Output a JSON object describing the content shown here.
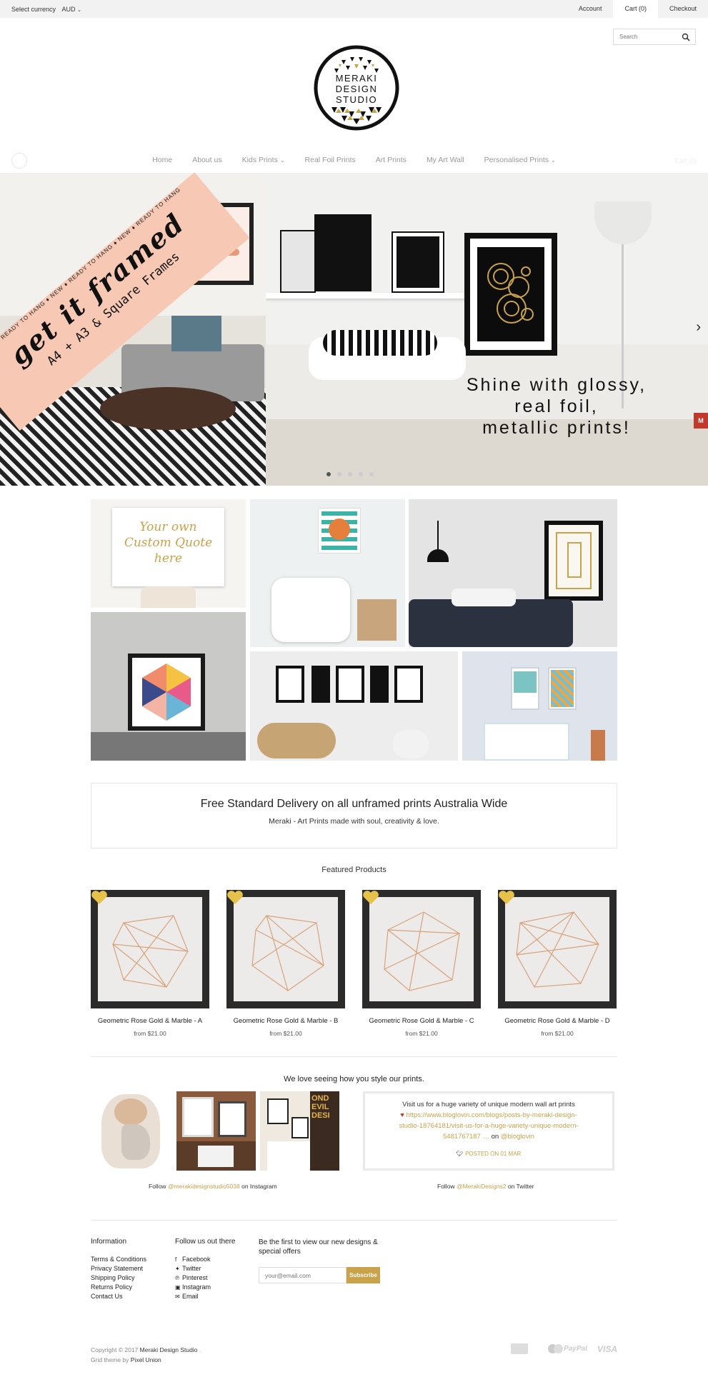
{
  "topbar": {
    "currency_label": "Select currency",
    "currency_value": "AUD",
    "account": "Account",
    "cart": "Cart (0)",
    "checkout": "Checkout"
  },
  "search": {
    "placeholder": "Search"
  },
  "logo": {
    "line1": "MERAKI",
    "line2": "DESIGN",
    "line3": "STUDIO"
  },
  "nav": {
    "items": [
      "Home",
      "About us",
      "Kids Prints",
      "Real Foil Prints",
      "Art Prints",
      "My Art Wall",
      "Personalised Prints"
    ],
    "cart_faint": "Cart (0)"
  },
  "hero": {
    "banner_main": "get it framed",
    "banner_small": "NEW ♦ READY TO HANG ♦ NEW ♦ READY TO HANG ♦ NEW ♦ READY TO HANG",
    "banner_sub": "A4 + A3 & Square Frames",
    "tagline_1": "Shine with glossy,",
    "tagline_2": "real foil,",
    "tagline_3": "metallic prints!",
    "slide_count": 5,
    "active_slide": 1
  },
  "collage": {
    "quote_text": "Your own Custom Quote here"
  },
  "delivery": {
    "headline": "Free Standard Delivery on all unframed prints Australia Wide",
    "subline": "Meraki - Art Prints made with soul, creativity & love."
  },
  "featured": {
    "title": "Featured Products",
    "products": [
      {
        "name": "Geometric Rose Gold & Marble - A",
        "price": "from $21.00"
      },
      {
        "name": "Geometric Rose Gold & Marble - B",
        "price": "from $21.00"
      },
      {
        "name": "Geometric Rose Gold & Marble - C",
        "price": "from $21.00"
      },
      {
        "name": "Geometric Rose Gold & Marble - D",
        "price": "from $21.00"
      }
    ]
  },
  "social": {
    "title": "We love seeing how you style our prints.",
    "instagram_follow_prefix": "Follow",
    "instagram_handle": "@merakidesignstudio5038",
    "instagram_suffix": "on Instagram",
    "tweet_text": "Visit us for a huge variety of unique modern wall art prints",
    "tweet_url": "https://www.bloglovin.com/blogs/posts-by-meraki-design-studio-18764181/visit-us-for-a-huge-variety-unique-modern-5481767187 …",
    "tweet_on": "on",
    "tweet_mention": "@bloglovin",
    "tweet_posted": "POSTED ON 01 MAR",
    "twitter_follow_prefix": "Follow",
    "twitter_handle": "@MerakiDesigns2",
    "twitter_suffix": "on Twitter"
  },
  "footer": {
    "info_title": "Information",
    "info_links": [
      "Terms & Conditions",
      "Privacy Statement",
      "Shipping Policy",
      "Returns Policy",
      "Contact Us"
    ],
    "follow_title": "Follow us out there",
    "follow_links": [
      {
        "label": "Facebook",
        "icon": "facebook-icon"
      },
      {
        "label": "Twitter",
        "icon": "twitter-icon"
      },
      {
        "label": "Pinterest",
        "icon": "pinterest-icon"
      },
      {
        "label": "Instagram",
        "icon": "instagram-icon"
      },
      {
        "label": "Email",
        "icon": "email-icon"
      }
    ],
    "newsletter_title": "Be the first to view our new designs & special offers",
    "email_placeholder": "your@email.com",
    "subscribe": "Subscribe",
    "copyright_prefix": "Copyright © 2017",
    "copyright_name": "Meraki Design Studio",
    "theme_prefix": "Grid theme by",
    "theme_name": "Pixel Union",
    "payments": [
      "AMEX",
      "MC",
      "PayPal",
      "VISA"
    ]
  },
  "colors": {
    "accent_gold": "#c9a24a",
    "topbar_bg": "#f2f2f2"
  }
}
